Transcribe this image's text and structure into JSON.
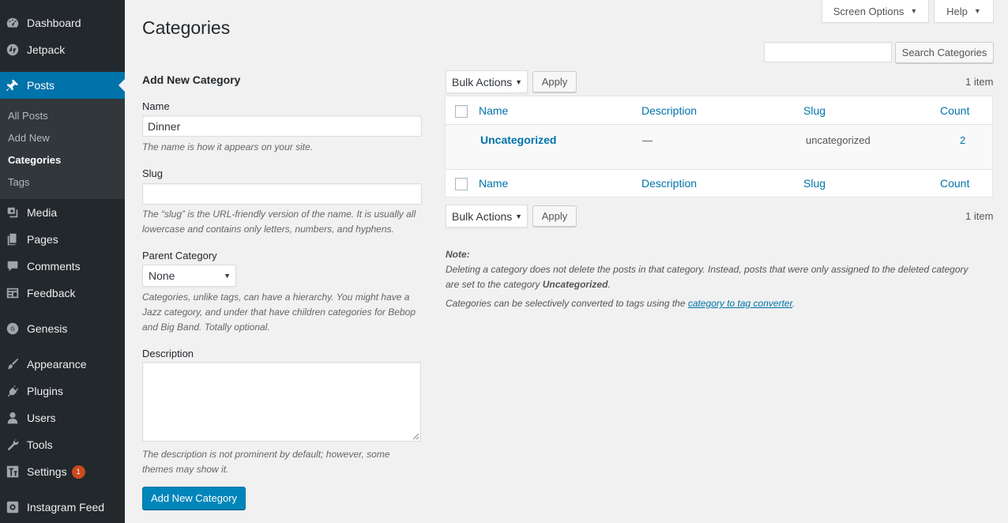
{
  "sidebar": {
    "items": [
      {
        "label": "Dashboard",
        "icon": "dashboard-icon"
      },
      {
        "label": "Jetpack",
        "icon": "jetpack-icon"
      },
      {
        "label": "Posts",
        "icon": "pin-icon"
      },
      {
        "label": "Media",
        "icon": "media-icon"
      },
      {
        "label": "Pages",
        "icon": "pages-icon"
      },
      {
        "label": "Comments",
        "icon": "comment-icon"
      },
      {
        "label": "Feedback",
        "icon": "feedback-icon"
      },
      {
        "label": "Genesis",
        "icon": "genesis-icon"
      },
      {
        "label": "Appearance",
        "icon": "brush-icon"
      },
      {
        "label": "Plugins",
        "icon": "plugin-icon"
      },
      {
        "label": "Users",
        "icon": "users-icon"
      },
      {
        "label": "Tools",
        "icon": "wrench-icon"
      },
      {
        "label": "Settings",
        "icon": "settings-icon"
      },
      {
        "label": "Instagram Feed",
        "icon": "instagram-icon"
      }
    ],
    "submenu": [
      "All Posts",
      "Add New",
      "Categories",
      "Tags"
    ],
    "settings_badge": "1"
  },
  "header": {
    "title": "Categories",
    "screen_options": "Screen Options",
    "help": "Help"
  },
  "search": {
    "value": "",
    "button": "Search Categories"
  },
  "form": {
    "heading": "Add New Category",
    "name_label": "Name",
    "name_value": "Dinner",
    "name_help": "The name is how it appears on your site.",
    "slug_label": "Slug",
    "slug_value": "",
    "slug_help_1": "The “slug” is the URL-friendly version of the name. It is usually all",
    "slug_help_2": "lowercase and contains only letters, numbers, and hyphens.",
    "parent_label": "Parent Category",
    "parent_value": "None",
    "parent_help_1": "Categories, unlike tags, can have a hierarchy. You might have a",
    "parent_help_2": "Jazz category, and under that have children categories for Bebop",
    "parent_help_3": "and Big Band. Totally optional.",
    "description_label": "Description",
    "description_value": "",
    "description_help_1": "The description is not prominent by default; however, some",
    "description_help_2": "themes may show it.",
    "submit": "Add New Category"
  },
  "list": {
    "bulk_actions": "Bulk Actions",
    "apply": "Apply",
    "count_text": "1 item",
    "columns": {
      "name": "Name",
      "description": "Description",
      "slug": "Slug",
      "count": "Count"
    },
    "rows": [
      {
        "name": "Uncategorized",
        "description": "—",
        "slug": "uncategorized",
        "count": "2"
      }
    ]
  },
  "note": {
    "title": "Note:",
    "line1": "Deleting a category does not delete the posts in that category. Instead, posts that were only assigned to the deleted category",
    "line2_prefix": "are set to the category ",
    "line2_bold": "Uncategorized",
    "line2_suffix": ".",
    "line3_prefix": "Categories can be selectively converted to tags using the ",
    "line3_link": "category to tag converter",
    "line3_suffix": "."
  },
  "colors": {
    "sidebar_bg": "#23282d",
    "active_bg": "#0073aa",
    "link": "#0073aa",
    "primary_button": "#0085ba",
    "badge": "#ca4a1f"
  }
}
